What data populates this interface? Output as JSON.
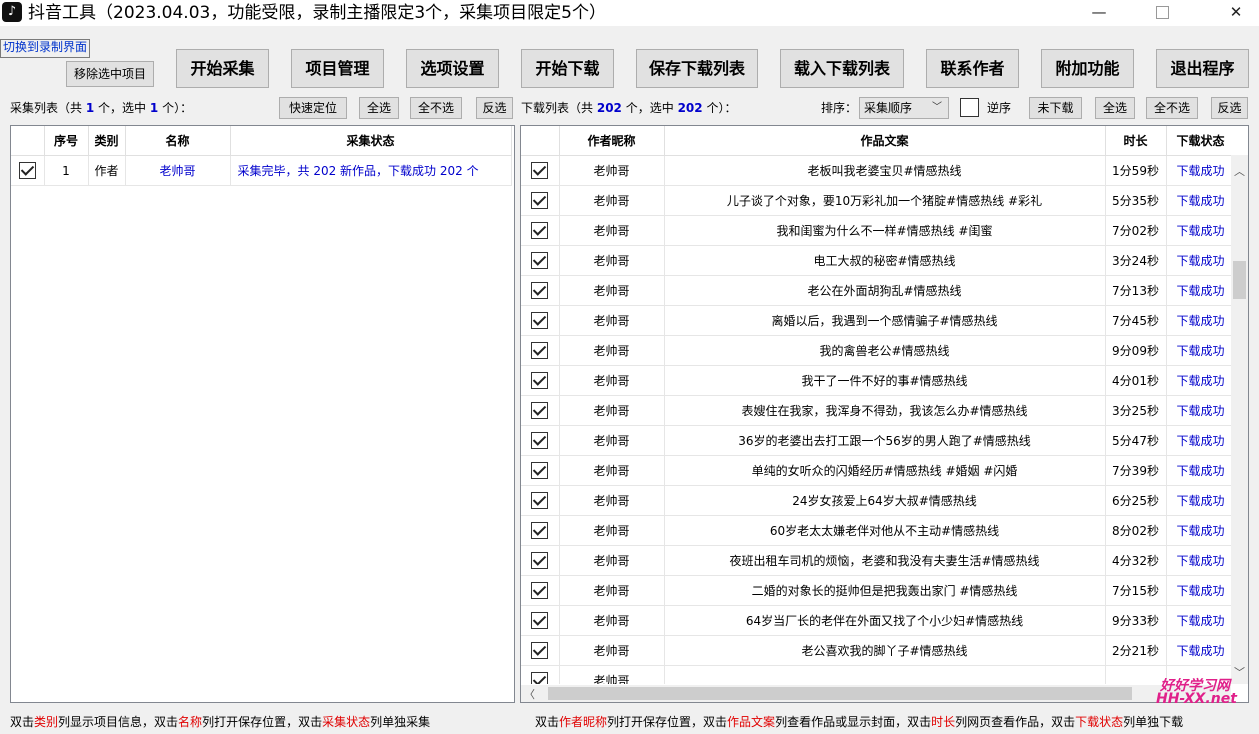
{
  "window": {
    "title": "抖音工具（2023.04.03，功能受限，录制主播限定3个，采集项目限定5个）",
    "controls": {
      "minimize": "—",
      "close": "✕"
    }
  },
  "top_links": {
    "switch_record": "切换到录制界面",
    "remove_selected": "移除选中项目"
  },
  "toolbar": {
    "start_collect": "开始采集",
    "project_manage": "项目管理",
    "options": "选项设置",
    "start_download": "开始下载",
    "save_list": "保存下载列表",
    "load_list": "载入下载列表",
    "contact_author": "联系作者",
    "extra": "附加功能",
    "exit": "退出程序"
  },
  "collect_bar": {
    "prefix": "采集列表（共",
    "total": "1",
    "mid": "个，选中",
    "selected": "1",
    "suffix": "个）：",
    "quick_locate": "快速定位",
    "select_all": "全选",
    "select_none": "全不选",
    "invert": "反选"
  },
  "download_bar": {
    "prefix": "下载列表（共",
    "total": "202",
    "mid": "个，选中",
    "selected": "202",
    "suffix": "个）：",
    "sort_label": "排序：",
    "sort_value": "采集顺序",
    "reverse_label": "逆序",
    "not_downloaded": "未下载",
    "select_all": "全选",
    "select_none": "全不选",
    "invert": "反选"
  },
  "collect_table": {
    "headers": [
      "",
      "序号",
      "类别",
      "名称",
      "采集状态"
    ],
    "rows": [
      {
        "index": "1",
        "type": "作者",
        "name": "老帅哥",
        "status": "采集完毕，共 202 新作品，下载成功 202 个"
      }
    ]
  },
  "download_table": {
    "headers": [
      "",
      "作者昵称",
      "作品文案",
      "时长",
      "下载状态"
    ],
    "rows": [
      {
        "author": "老帅哥",
        "text": "老板叫我老婆宝贝#情感热线",
        "duration": "1分59秒",
        "status": "下载成功"
      },
      {
        "author": "老帅哥",
        "text": "儿子谈了个对象，要10万彩礼加一个猪腚#情感热线 #彩礼",
        "duration": "5分35秒",
        "status": "下载成功"
      },
      {
        "author": "老帅哥",
        "text": "我和闺蜜为什么不一样#情感热线 #闺蜜",
        "duration": "7分02秒",
        "status": "下载成功"
      },
      {
        "author": "老帅哥",
        "text": "电工大叔的秘密#情感热线",
        "duration": "3分24秒",
        "status": "下载成功"
      },
      {
        "author": "老帅哥",
        "text": "老公在外面胡狗乱#情感热线",
        "duration": "7分13秒",
        "status": "下载成功"
      },
      {
        "author": "老帅哥",
        "text": "离婚以后，我遇到一个感情骗子#情感热线",
        "duration": "7分45秒",
        "status": "下载成功"
      },
      {
        "author": "老帅哥",
        "text": "我的禽兽老公#情感热线",
        "duration": "9分09秒",
        "status": "下载成功"
      },
      {
        "author": "老帅哥",
        "text": "我干了一件不好的事#情感热线",
        "duration": "4分01秒",
        "status": "下载成功"
      },
      {
        "author": "老帅哥",
        "text": "表嫂住在我家，我浑身不得劲，我该怎么办#情感热线",
        "duration": "3分25秒",
        "status": "下载成功"
      },
      {
        "author": "老帅哥",
        "text": "36岁的老婆出去打工跟一个56岁的男人跑了#情感热线",
        "duration": "5分47秒",
        "status": "下载成功"
      },
      {
        "author": "老帅哥",
        "text": "单纯的女听众的闪婚经历#情感热线 #婚姻 #闪婚",
        "duration": "7分39秒",
        "status": "下载成功"
      },
      {
        "author": "老帅哥",
        "text": "24岁女孩爱上64岁大叔#情感热线",
        "duration": "6分25秒",
        "status": "下载成功"
      },
      {
        "author": "老帅哥",
        "text": "60岁老太太嫌老伴对他从不主动#情感热线",
        "duration": "8分02秒",
        "status": "下载成功"
      },
      {
        "author": "老帅哥",
        "text": "夜班出租车司机的烦恼，老婆和我没有夫妻生活#情感热线",
        "duration": "4分32秒",
        "status": "下载成功"
      },
      {
        "author": "老帅哥",
        "text": "二婚的对象长的挺帅但是把我轰出家门 #情感热线",
        "duration": "7分15秒",
        "status": "下载成功"
      },
      {
        "author": "老帅哥",
        "text": "64岁当厂长的老伴在外面又找了个小少妇#情感热线",
        "duration": "9分33秒",
        "status": "下载成功"
      },
      {
        "author": "老帅哥",
        "text": "老公喜欢我的脚丫子#情感热线",
        "duration": "2分21秒",
        "status": "下载成功"
      },
      {
        "author": "老帅哥",
        "text": "",
        "duration": "",
        "status": ""
      }
    ]
  },
  "footer_left": {
    "p1": "双击",
    "k1": "类别",
    "p2": "列显示项目信息，双击",
    "k2": "名称",
    "p3": "列打开保存位置，双击",
    "k3": "采集状态",
    "p4": "列单独采集"
  },
  "footer_right": {
    "p1": "双击",
    "k1": "作者昵称",
    "p2": "列打开保存位置，双击",
    "k2": "作品文案",
    "p3": "列查看作品或显示封面，双击",
    "k3": "时长",
    "p4": "列网页查看作品，双击",
    "k4": "下载状态",
    "p5": "列单独下载"
  },
  "watermark": {
    "line1": "好好学习网",
    "line2": "HH-XX.net"
  },
  "colors": {
    "accent_blue": "#0000cc",
    "highlight_red": "#e00000",
    "watermark": "#e0208a"
  }
}
